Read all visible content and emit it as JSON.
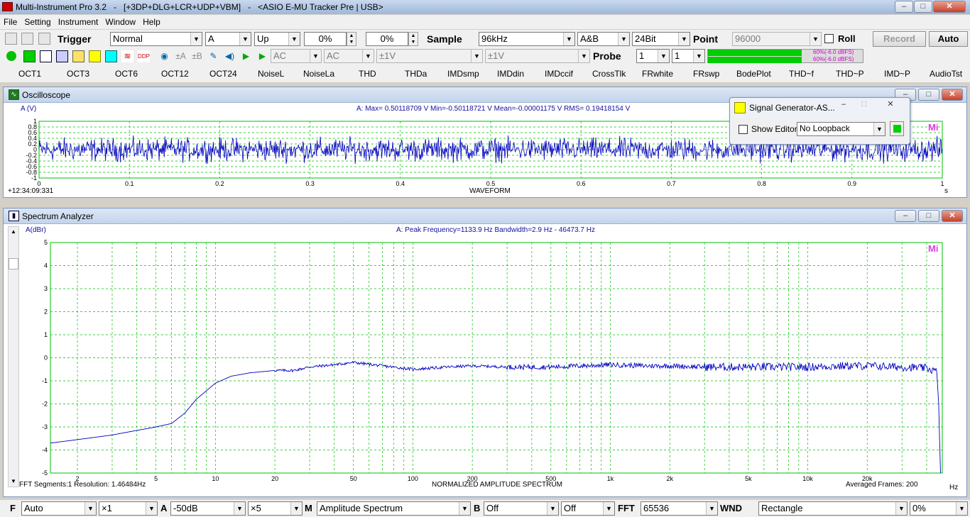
{
  "window": {
    "title": "Multi-Instrument Pro 3.2   -   [+3DP+DLG+LCR+UDP+VBM]   -   <ASIO E-MU Tracker Pre | USB>",
    "min_label": "–",
    "max_label": "□",
    "close_label": "✕"
  },
  "menu": [
    "File",
    "Setting",
    "Instrument",
    "Window",
    "Help"
  ],
  "toolbar1": {
    "trigger_label": "Trigger",
    "trigger_mode": "Normal",
    "trigger_channel": "A",
    "trigger_edge": "Up",
    "trigger_level": "0%",
    "trigger_delay": "0%",
    "sample_label": "Sample",
    "sample_rate": "96kHz",
    "channels": "A&B",
    "bit_depth": "24Bit",
    "point_label": "Point",
    "point_value": "96000",
    "roll_label": "Roll",
    "record_label": "Record",
    "auto_label": "Auto"
  },
  "toolbar2": {
    "coupling_a": "AC",
    "coupling_b": "AC",
    "range_a": "±1V",
    "range_b": "±1V",
    "probe_label": "Probe",
    "probe_a": "1",
    "probe_b": "1",
    "meter_a_label": "60%(-6.0 dBFS)",
    "meter_b_label": "60%(-6.0 dBFS)",
    "meter_a_level": 0.6,
    "meter_b_level": 0.6
  },
  "function_buttons": [
    "OCT1",
    "OCT3",
    "OCT6",
    "OCT12",
    "OCT24",
    "NoiseL",
    "NoiseLa",
    "THD",
    "THDa",
    "IMDsmp",
    "IMDdin",
    "IMDccif",
    "CrossTlk",
    "FRwhite",
    "FRswp",
    "BodePlot",
    "THD~f",
    "THD~P",
    "IMD~P",
    "AudioTst"
  ],
  "oscilloscope": {
    "title": "Oscilloscope",
    "channel_label": "A (V)",
    "stats": "A:  Max= 0.50118709 V  Min=-0.50118721 V  Mean=-0.00001175 V  RMS= 0.19418154 V",
    "timestamp": "+12:34:09:331",
    "xaxis_label": "WAVEFORM",
    "xunit": "s",
    "logo": "Mi",
    "y_ticks": [
      "1",
      "0.8",
      "0.6",
      "0.4",
      "0.2",
      "0",
      "-0.2",
      "-0.4",
      "-0.6",
      "-0.8",
      "-1"
    ],
    "x_ticks": [
      "0",
      "0.1",
      "0.2",
      "0.3",
      "0.4",
      "0.5",
      "0.6",
      "0.7",
      "0.8",
      "0.9",
      "1"
    ]
  },
  "signal_generator": {
    "title": "Signal Generator-AS...",
    "show_editor_label": "Show Editor",
    "loopback": "No Loopback"
  },
  "spectrum": {
    "title": "Spectrum Analyzer",
    "channel_label": "A(dBr)",
    "stats": "A: Peak Frequency=1133.9 Hz  Bandwidth=2.9 Hz - 46473.7 Hz",
    "footer_left": "FFT Segments:1     Resolution: 1.46484Hz",
    "xaxis_label": "NORMALIZED AMPLITUDE SPECTRUM",
    "footer_right": "Averaged Frames: 200",
    "xunit": "Hz",
    "logo": "Mi",
    "y_ticks": [
      "5",
      "4",
      "3",
      "2",
      "1",
      "0",
      "-1",
      "-2",
      "-3",
      "-4",
      "-5"
    ],
    "x_ticks": [
      "2",
      "5",
      "10",
      "20",
      "50",
      "100",
      "200",
      "500",
      "1k",
      "2k",
      "5k",
      "10k",
      "20k"
    ]
  },
  "bottom": {
    "f_label": "F",
    "window_mode": "Auto",
    "multiplier": "×1",
    "a_label": "A",
    "a_range": "-50dB",
    "a_mult": "×5",
    "m_label": "M",
    "m_mode": "Amplitude Spectrum",
    "b_label": "B",
    "b_mode1": "Off",
    "b_mode2": "Off",
    "fft_label": "FFT",
    "fft_size": "65536",
    "wnd_label": "WND",
    "wnd_type": "Rectangle",
    "overlap": "0%"
  },
  "colors": {
    "trace": "#0000c0",
    "grid": "#00c000",
    "logo": "#e040e0",
    "meter": "#00cc00"
  },
  "chart_data": [
    {
      "type": "line",
      "title": "Oscilloscope",
      "xlabel": "WAVEFORM",
      "ylabel": "A (V)",
      "xlim": [
        0,
        1
      ],
      "ylim": [
        -1,
        1
      ],
      "grid": true,
      "series": [
        {
          "name": "A",
          "description_values": {
            "max": 0.50118709,
            "min": -0.50118721,
            "mean": -1.175e-05,
            "rms": 0.19418154
          }
        }
      ]
    },
    {
      "type": "line",
      "title": "Spectrum Analyzer",
      "xlabel": "NORMALIZED AMPLITUDE SPECTRUM",
      "ylabel": "A(dBr)",
      "xscale": "log",
      "xlim": [
        1.46,
        48000
      ],
      "ylim": [
        -5,
        5
      ],
      "grid": true,
      "series": [
        {
          "name": "A",
          "x": [
            1.46,
            2,
            3,
            4,
            5,
            6,
            7,
            8,
            10,
            12,
            15,
            20,
            25,
            30,
            40,
            50,
            70,
            100,
            150,
            200,
            300,
            500,
            700,
            1000,
            1500,
            2000,
            3000,
            5000,
            7000,
            10000,
            15000,
            20000,
            30000,
            40000,
            45000,
            46000,
            47000
          ],
          "y": [
            -3.7,
            -3.55,
            -3.35,
            -3.15,
            -3.0,
            -2.85,
            -2.4,
            -1.8,
            -1.1,
            -0.8,
            -0.65,
            -0.55,
            -0.55,
            -0.4,
            -0.3,
            -0.2,
            -0.35,
            -0.5,
            -0.4,
            -0.35,
            -0.4,
            -0.4,
            -0.35,
            -0.3,
            -0.35,
            -0.35,
            -0.4,
            -0.4,
            -0.4,
            -0.4,
            -0.35,
            -0.35,
            -0.4,
            -0.45,
            -0.6,
            -2.0,
            -5.0
          ]
        }
      ]
    }
  ]
}
